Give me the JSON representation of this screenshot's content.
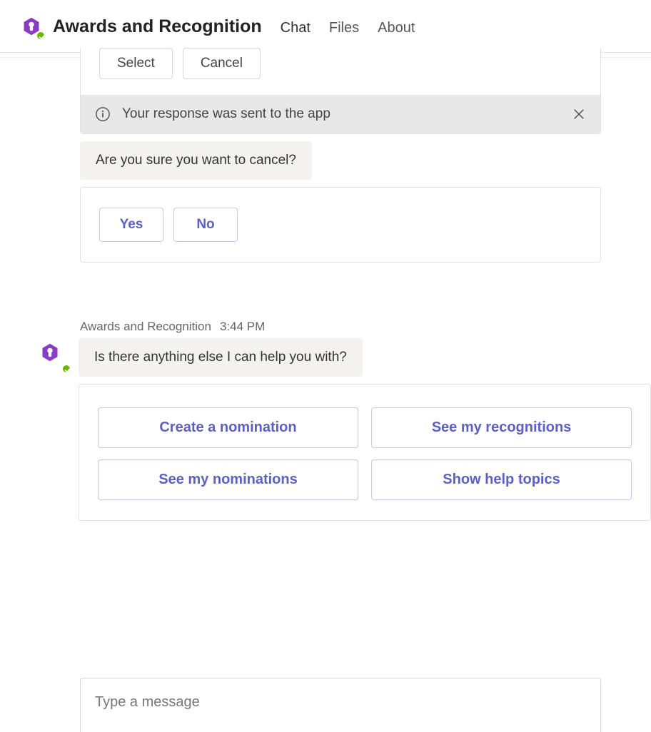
{
  "header": {
    "title": "Awards and Recognition",
    "tabs": [
      {
        "label": "Chat",
        "active": true
      },
      {
        "label": "Files",
        "active": false
      },
      {
        "label": "About",
        "active": false
      }
    ]
  },
  "icons": {
    "app_hex_color": "#8a3cc7",
    "status": "available"
  },
  "partial_card": {
    "buttons": [
      "Select",
      "Cancel"
    ]
  },
  "notice": {
    "text": "Your response was sent to the app"
  },
  "bubble_confirm": {
    "text": "Are you sure you want to cancel?",
    "options": [
      "Yes",
      "No"
    ]
  },
  "second_msg": {
    "sender": "Awards and Recognition",
    "time": "3:44 PM",
    "text": "Is there anything else I can help you with?",
    "options": [
      "Create a nomination",
      "See my recognitions",
      "See my nominations",
      "Show help topics"
    ]
  },
  "compose": {
    "placeholder": "Type a message"
  }
}
